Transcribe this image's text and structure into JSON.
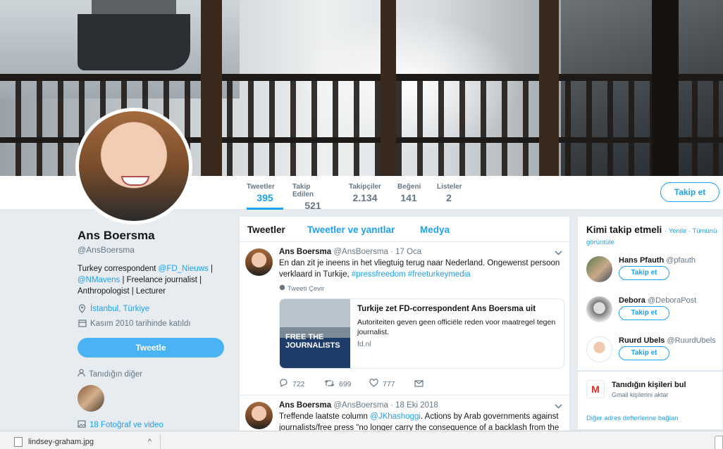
{
  "profile": {
    "name": "Ans Boersma",
    "handle": "@AnsBoersma",
    "bio_prefix": "Turkey correspondent ",
    "bio_mention1": "@FD_Nieuws",
    "bio_sep": " | ",
    "bio_mention2": "@NMavens",
    "bio_rest": " | Freelance journalist | Anthropologist | Lecturer",
    "location": "İstanbul, Türkiye",
    "joined": "Kasım 2010 tarihinde katıldı",
    "tweet_button": "Tweetle",
    "known_label": "Tanıdığın diğer",
    "photos_label": "18 Fotoğraf ve video"
  },
  "nav": [
    {
      "label": "Tweetler",
      "value": "395"
    },
    {
      "label": "Takip Edilen",
      "value": "521"
    },
    {
      "label": "Takipçiler",
      "value": "2.134"
    },
    {
      "label": "Beğeni",
      "value": "141"
    },
    {
      "label": "Listeler",
      "value": "2"
    }
  ],
  "follow_button": "Takip et",
  "tabs": [
    "Tweetler",
    "Tweetler ve yanıtlar",
    "Medya"
  ],
  "tweets": [
    {
      "name": "Ans Boersma",
      "handle": "@AnsBoersma",
      "date": "· 17 Oca",
      "text": "En dan zit je ineens in het vliegtuig terug naar Nederland. Ongewenst persoon verklaard in Turkije, ",
      "hashtags": "#pressfreedom #freeturkeymedia",
      "translate": "Tweeti Çevir",
      "card": {
        "image_text": "FREE THE JOURNALISTS",
        "title": "Turkije zet FD-correspondent Ans Boersma uit",
        "description": "Autoriteiten geven geen officiële reden voor maatregel tegen journalist.",
        "domain": "fd.nl"
      },
      "replies": "722",
      "retweets": "699",
      "likes": "777"
    },
    {
      "name": "Ans Boersma",
      "handle": "@AnsBoersma",
      "date": "· 18 Eki 2018",
      "text_prefix": "Treffende laatste column ",
      "mention": "@JKhashoggi",
      "text_rest": ". Actions by Arab governments against journalists/free press \"no longer carry the consequence of a backlash from the"
    }
  ],
  "who_to_follow": {
    "title": "Kimi takip etmeli",
    "sub": "· Yenile · Tümünü görüntüle",
    "suggestions": [
      {
        "name": "Hans Pfauth",
        "handle": "@pfauth",
        "button": "Takip et"
      },
      {
        "name": "Debora",
        "handle": "@DeboraPost",
        "button": "Takip et"
      },
      {
        "name": "Ruurd Ubels",
        "handle": "@RuurdUbels",
        "button": "Takip et"
      }
    ]
  },
  "contacts": {
    "icon_letter": "M",
    "title": "Tanıdığın kişileri bul",
    "sub": "Gmail kişilerini aktar",
    "link": "Diğer adres defterlerine bağlan"
  },
  "download": {
    "filename": "lindsey-graham.jpg",
    "chevron": "^"
  },
  "colors": {
    "accent": "#1da1f2",
    "background": "#e6ecf0"
  }
}
